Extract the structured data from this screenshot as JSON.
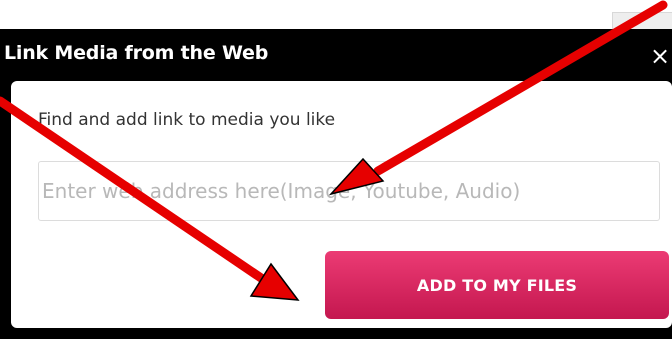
{
  "dialog": {
    "title": "Link Media from the Web",
    "close_label": "×",
    "prompt": "Find and add link to media you like",
    "url_input": {
      "value": "",
      "placeholder": "Enter web address here(Image, Youtube, Audio)"
    },
    "add_button_label": "ADD TO MY FILES"
  },
  "annotations": {
    "arrow_color": "#e60000"
  },
  "colors": {
    "button_top": "#ec3b74",
    "button_bottom": "#c4174f",
    "titlebar": "#000000"
  }
}
